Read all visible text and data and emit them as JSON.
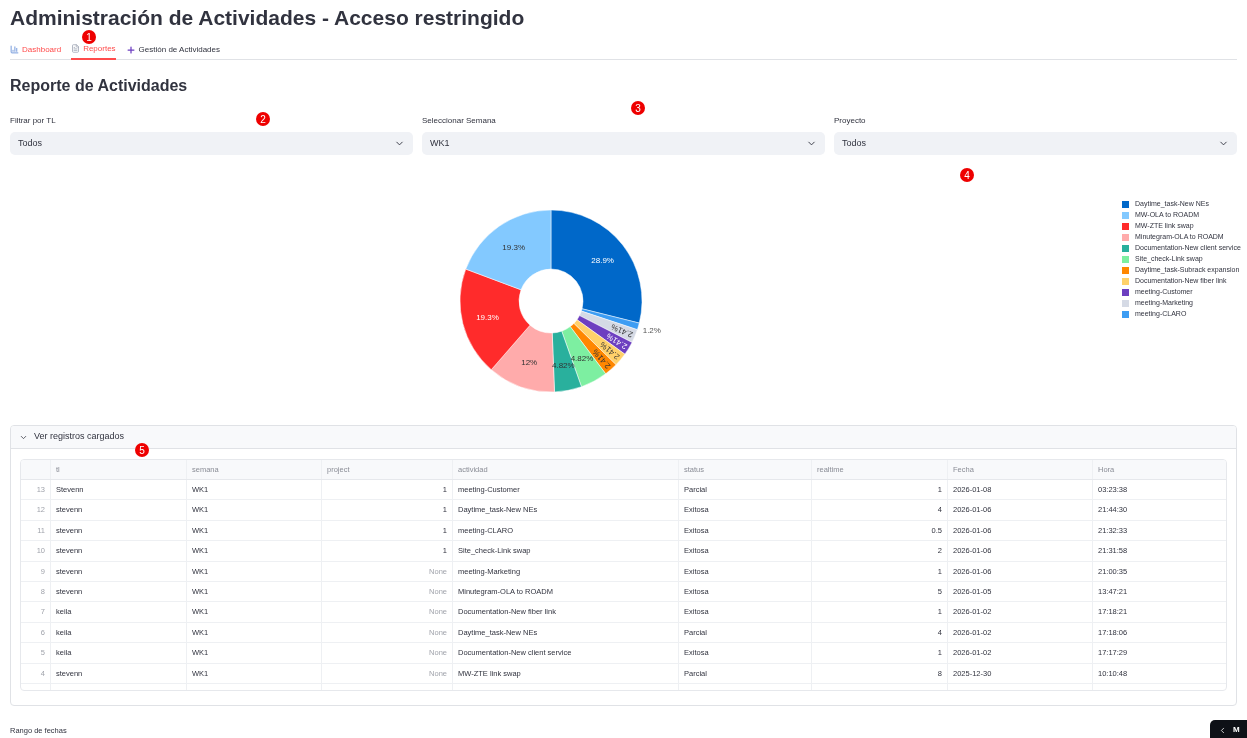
{
  "title": "Administración de Actividades - Acceso restringido",
  "tabs": [
    {
      "label": "Dashboard",
      "selected": false
    },
    {
      "label": "Reportes",
      "selected": true
    },
    {
      "label": "Gestión de Actividades",
      "selected": false
    }
  ],
  "heading": "Reporte de Actividades",
  "filters": [
    {
      "label": "Filtrar por TL",
      "value": "Todos"
    },
    {
      "label": "Seleccionar Semana",
      "value": "WK1"
    },
    {
      "label": "Proyecto",
      "value": "Todos"
    }
  ],
  "chart_data": {
    "type": "donut",
    "data_labels": true,
    "categories": [
      "Daytime_task-New NEs",
      "MW-OLA to ROADM",
      "MW-ZTE link swap",
      "Minutegram-OLA to ROADM",
      "Documentation-New client service",
      "Site_check-Link swap",
      "Daytime_task-Subrack expansion",
      "Documentation-New fiber link",
      "meeting-Customer",
      "meeting-Marketing",
      "meeting-CLARO"
    ],
    "values": [
      28.9,
      19.3,
      19.3,
      12,
      4.82,
      4.82,
      2.41,
      2.41,
      2.41,
      2.41,
      1.2
    ],
    "value_labels": [
      "28.9%",
      "19.3%",
      "19.3%",
      "12%",
      "4.82%",
      "4.82%",
      "2.41%",
      "2.41%",
      "2.41%",
      "2.41%",
      "1.2%"
    ],
    "colors": [
      "#0068c9",
      "#83c9ff",
      "#ff2b2b",
      "#ffabab",
      "#29b09d",
      "#7defa1",
      "#ff8700",
      "#ffd16a",
      "#6d3fc0",
      "#d5dae5",
      "#3d9df3"
    ]
  },
  "expander": {
    "label": "Ver registros cargados",
    "expanded": true
  },
  "table": {
    "columns": [
      "",
      "tl",
      "semana",
      "project",
      "actividad",
      "status",
      "realtime",
      "Fecha",
      "Hora"
    ],
    "rows": [
      [
        "13",
        "Stevenn",
        "WK1",
        "1",
        "meeting-Customer",
        "Parcial",
        "1",
        "2026-01-08",
        "03:23:38"
      ],
      [
        "12",
        "stevenn",
        "WK1",
        "1",
        "Daytime_task-New NEs",
        "Exitosa",
        "4",
        "2026-01-06",
        "21:44:30"
      ],
      [
        "11",
        "stevenn",
        "WK1",
        "1",
        "meeting-CLARO",
        "Exitosa",
        "0.5",
        "2026-01-06",
        "21:32:33"
      ],
      [
        "10",
        "stevenn",
        "WK1",
        "1",
        "Site_check-Link swap",
        "Exitosa",
        "2",
        "2026-01-06",
        "21:31:58"
      ],
      [
        "9",
        "stevenn",
        "WK1",
        "None",
        "meeting-Marketing",
        "Exitosa",
        "1",
        "2026-01-06",
        "21:00:35"
      ],
      [
        "8",
        "stevenn",
        "WK1",
        "None",
        "Minutegram-OLA to ROADM",
        "Exitosa",
        "5",
        "2026-01-05",
        "13:47:21"
      ],
      [
        "7",
        "keila",
        "WK1",
        "None",
        "Documentation-New fiber link",
        "Exitosa",
        "1",
        "2026-01-02",
        "17:18:21"
      ],
      [
        "6",
        "keila",
        "WK1",
        "None",
        "Daytime_task-New NEs",
        "Parcial",
        "4",
        "2026-01-02",
        "17:18:06"
      ],
      [
        "5",
        "keila",
        "WK1",
        "None",
        "Documentation-New client service",
        "Exitosa",
        "1",
        "2026-01-02",
        "17:17:29"
      ],
      [
        "4",
        "stevenn",
        "WK1",
        "None",
        "MW-ZTE link swap",
        "Parcial",
        "8",
        "2025-12-30",
        "10:10:48"
      ]
    ]
  },
  "footer_label": "Rango de fechas",
  "corner_button": {
    "label": "M"
  },
  "markers": [
    {
      "label": "1"
    },
    {
      "label": "2"
    },
    {
      "label": "3"
    },
    {
      "label": "4"
    },
    {
      "label": "5"
    }
  ]
}
